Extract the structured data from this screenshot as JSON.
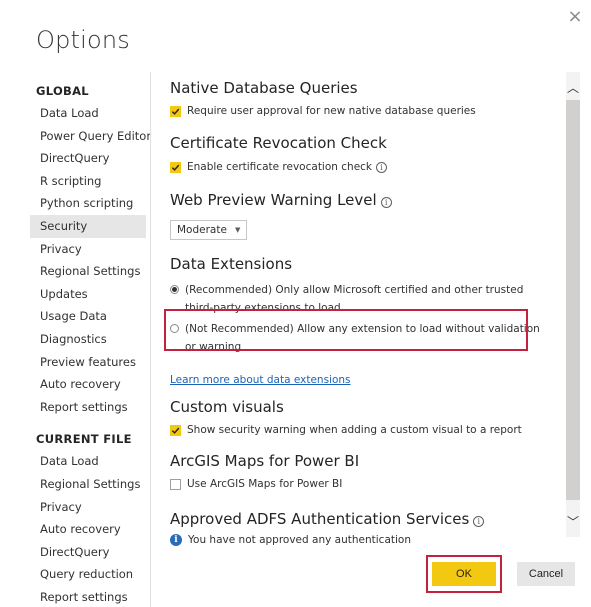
{
  "dialog": {
    "title": "Options",
    "close_symbol": "×"
  },
  "nav": {
    "global_heading": "GLOBAL",
    "global_items": [
      {
        "label": "Data Load"
      },
      {
        "label": "Power Query Editor"
      },
      {
        "label": "DirectQuery"
      },
      {
        "label": "R scripting"
      },
      {
        "label": "Python scripting"
      },
      {
        "label": "Security",
        "selected": true
      },
      {
        "label": "Privacy"
      },
      {
        "label": "Regional Settings"
      },
      {
        "label": "Updates"
      },
      {
        "label": "Usage Data"
      },
      {
        "label": "Diagnostics"
      },
      {
        "label": "Preview features"
      },
      {
        "label": "Auto recovery"
      },
      {
        "label": "Report settings"
      }
    ],
    "current_heading": "CURRENT FILE",
    "current_items": [
      {
        "label": "Data Load"
      },
      {
        "label": "Regional Settings"
      },
      {
        "label": "Privacy"
      },
      {
        "label": "Auto recovery"
      },
      {
        "label": "DirectQuery"
      },
      {
        "label": "Query reduction"
      },
      {
        "label": "Report settings"
      }
    ]
  },
  "content": {
    "native_db": {
      "title": "Native Database Queries",
      "checkbox_label": "Require user approval for new native database queries",
      "checked": true
    },
    "cert_revocation": {
      "title": "Certificate Revocation Check",
      "checkbox_label": "Enable certificate revocation check",
      "checked": true
    },
    "web_preview": {
      "title": "Web Preview Warning Level",
      "selected_value": "Moderate"
    },
    "data_extensions": {
      "title": "Data Extensions",
      "option1_line1": "(Recommended) Only allow Microsoft certified and other trusted",
      "option1_line2": "third-party extensions to load",
      "option2_line1": "(Not Recommended) Allow any extension to load without validation",
      "option2_line2": "or warning",
      "selected_option": 1,
      "learn_more_link": "Learn more about data extensions"
    },
    "custom_visuals": {
      "title": "Custom visuals",
      "checkbox_label": "Show security warning when adding a custom visual to a report",
      "checked": true
    },
    "arcgis": {
      "title": "ArcGIS Maps for Power BI",
      "checkbox_label": "Use ArcGIS Maps for Power BI",
      "checked": false
    },
    "adfs": {
      "title": "Approved ADFS Authentication Services",
      "info_text": "You have not approved any authentication"
    }
  },
  "buttons": {
    "ok_label": "OK",
    "cancel_label": "Cancel"
  },
  "colors": {
    "accent_yellow": "#f2c811",
    "highlight_red": "#c2223f",
    "link_blue": "#1a63b8",
    "selected_nav_bg": "#e6e6e6"
  }
}
